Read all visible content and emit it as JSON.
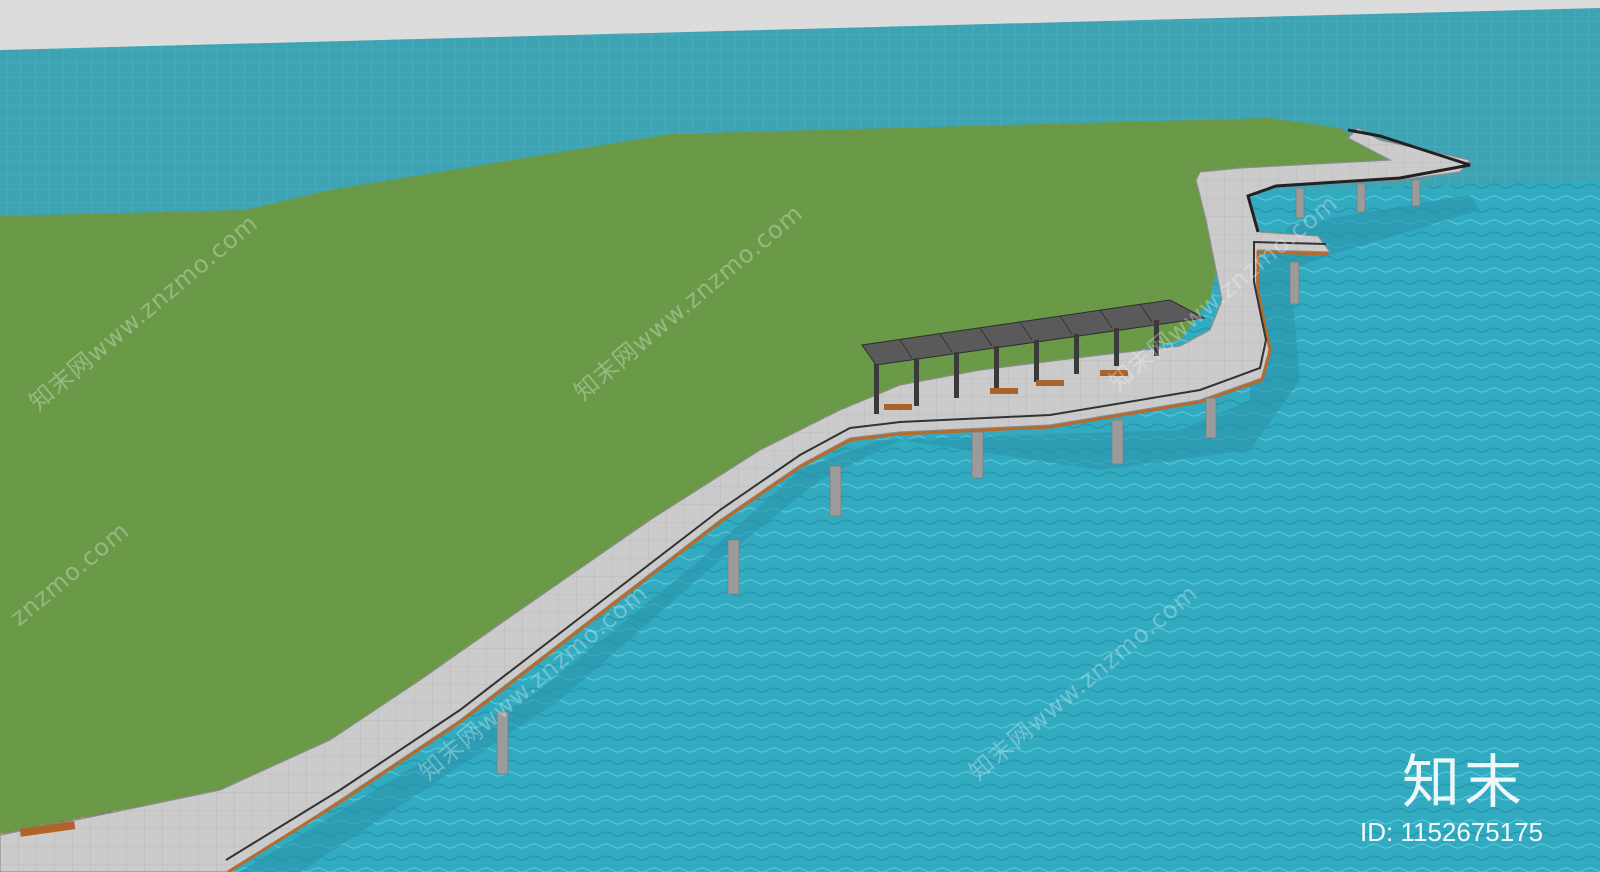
{
  "watermarks": {
    "diagonal_text": "知末网www.znzmo.com",
    "diagonal_text_partial": "znzmo.com"
  },
  "brand": {
    "logo_text": "知末",
    "id_text": "ID: 1152675175"
  },
  "colors": {
    "sky": "#dcdcdc",
    "water_far": "#3ea3b3",
    "water_near": "#2fb2cc",
    "grass": "#6a9a48",
    "walkway": "#c9c9c9",
    "railing_wood": "#b76a2c",
    "stone_edge": "#8a7c6c",
    "pier": "#9b9b9b",
    "pavilion_roof": "#5a5a5a"
  }
}
